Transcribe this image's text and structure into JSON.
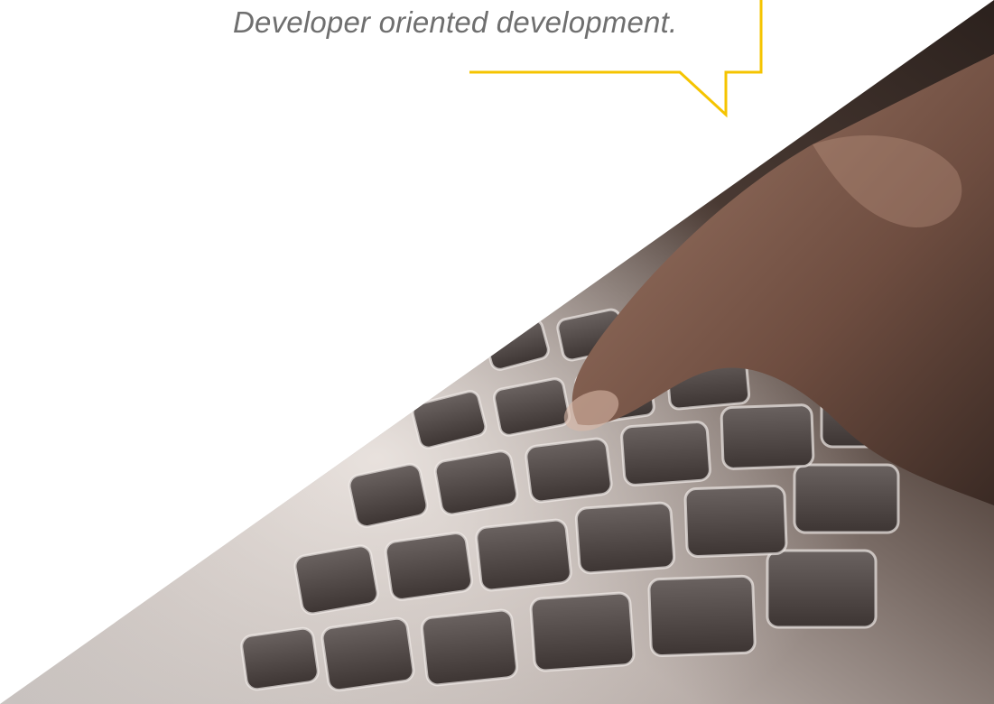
{
  "callout": {
    "text": "Developer oriented development.",
    "border_color": "#f5c400"
  },
  "photo": {
    "subject": "hand-typing-on-laptop-keyboard-photo",
    "tone_dark": "#2a2522",
    "tone_light": "#e9e2dc",
    "skin": "#8a6a5a"
  }
}
